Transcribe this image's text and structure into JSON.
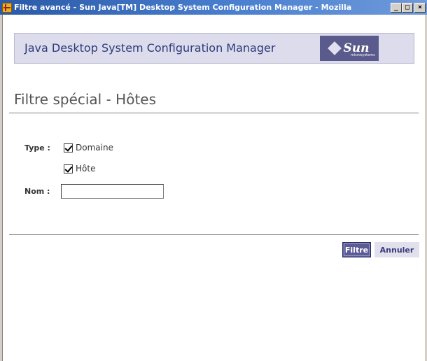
{
  "window": {
    "title": "Filtre avancé - Sun Java[TM] Desktop System Configuration Manager - Mozilla",
    "minimize": "_",
    "maximize": "□",
    "close": "×"
  },
  "masthead": {
    "title": "Java Desktop System Configuration Manager",
    "logo_text": "Sun",
    "logo_subtext": "microsystems"
  },
  "page": {
    "title": "Filtre spécial - Hôtes"
  },
  "form": {
    "type_label": "Type :",
    "options": [
      {
        "label": "Domaine",
        "checked": true
      },
      {
        "label": "Hôte",
        "checked": true
      }
    ],
    "name_label": "Nom :",
    "name_value": ""
  },
  "buttons": {
    "filter": "Filtre",
    "cancel": "Annuler"
  },
  "colors": {
    "titlebar": "#2a5aa8",
    "masthead_bar": "#dcdcec",
    "primary_button": "#5b5b95",
    "secondary_button": "#e1e1ee"
  }
}
